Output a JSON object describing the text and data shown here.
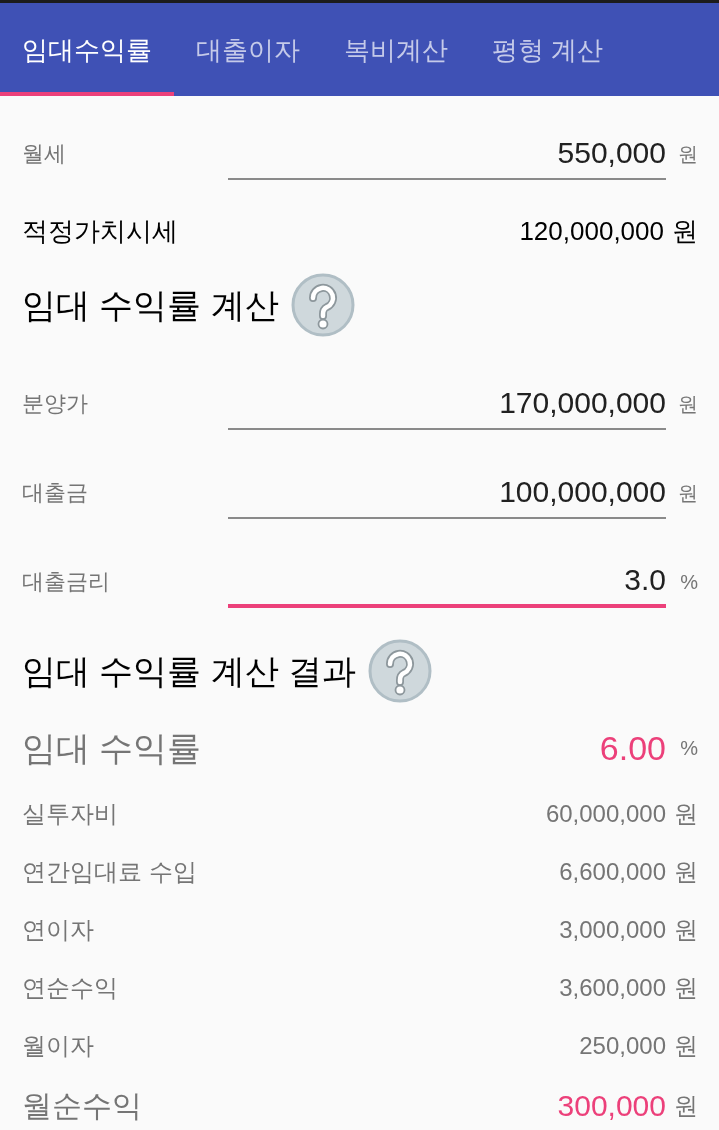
{
  "tabs": [
    {
      "label": "임대수익률",
      "selected": true
    },
    {
      "label": "대출이자",
      "selected": false
    },
    {
      "label": "복비계산",
      "selected": false
    },
    {
      "label": "평형 계산",
      "selected": false
    }
  ],
  "monthly_rent": {
    "label": "월세",
    "value": "550,000",
    "unit": "원",
    "focused": false
  },
  "fair_value": {
    "label": "적정가치시세",
    "value": "120,000,000",
    "unit": "원"
  },
  "calc_section": {
    "title": "임대 수익률 계산",
    "fields": [
      {
        "label": "분양가",
        "value": "170,000,000",
        "unit": "원",
        "focused": false
      },
      {
        "label": "대출금",
        "value": "100,000,000",
        "unit": "원",
        "focused": false
      },
      {
        "label": "대출금리",
        "value": "3.0",
        "unit": "%",
        "focused": true
      }
    ]
  },
  "result_section": {
    "title": "임대 수익률 계산 결과",
    "rate": {
      "label": "임대 수익률",
      "value": "6.00",
      "unit": "%"
    },
    "rows": [
      {
        "label": "실투자비",
        "value": "60,000,000",
        "unit": "원"
      },
      {
        "label": "연간임대료 수입",
        "value": "6,600,000",
        "unit": "원"
      },
      {
        "label": "연이자",
        "value": "3,000,000",
        "unit": "원"
      },
      {
        "label": "연순수익",
        "value": "3,600,000",
        "unit": "원"
      },
      {
        "label": "월이자",
        "value": "250,000",
        "unit": "원"
      }
    ],
    "total": {
      "label": "월순수익",
      "value": "300,000",
      "unit": "원"
    }
  }
}
